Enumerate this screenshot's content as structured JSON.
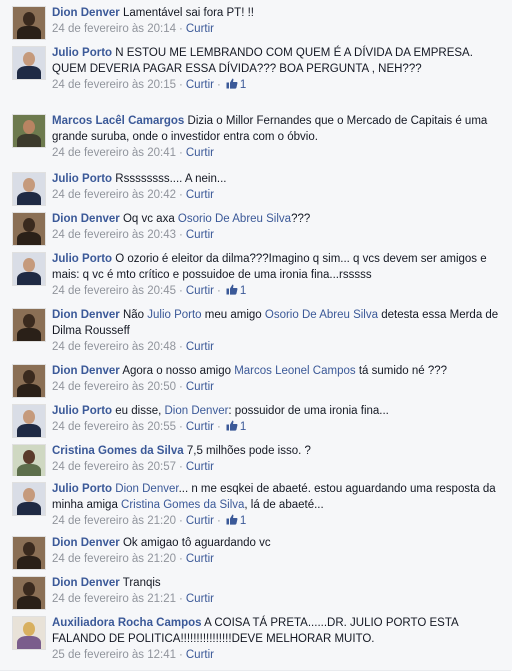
{
  "comments": [
    {
      "author": "Dion Denver",
      "avatar": "dark",
      "parts": [
        {
          "t": "Lamentável sai fora PT! !!"
        }
      ],
      "time": "24 de fevereiro às 20:14",
      "action": "Curtir",
      "likes": ""
    },
    {
      "author": "Julio Porto",
      "avatar": "suit",
      "parts": [
        {
          "t": "N ESTOU ME LEMBRANDO COM QUEM É A DÍVIDA DA EMPRESA. QUEM DEVERIA PAGAR ESSA DÍVIDA??? BOA PERGUNTA , NEH???"
        }
      ],
      "time": "24 de fevereiro às 20:15",
      "action": "Curtir",
      "likes": "1"
    },
    {
      "author": "Marcos Lacêl Camargos",
      "avatar": "tan",
      "parts": [
        {
          "t": "Dizia o Millor Fernandes que o Mercado de Capitais é uma grande suruba, onde o investidor entra com o óbvio."
        }
      ],
      "time": "24 de fevereiro às 20:41",
      "action": "Curtir",
      "likes": ""
    },
    {
      "author": "Julio Porto",
      "avatar": "suit",
      "parts": [
        {
          "t": "Rssssssss.... A nein..."
        }
      ],
      "time": "24 de fevereiro às 20:42",
      "action": "Curtir",
      "likes": ""
    },
    {
      "author": "Dion Denver",
      "avatar": "dark",
      "parts": [
        {
          "t": "Oq vc axa "
        },
        {
          "m": "Osorio De Abreu Silva"
        },
        {
          "t": "???"
        }
      ],
      "time": "24 de fevereiro às 20:43",
      "action": "Curtir",
      "likes": ""
    },
    {
      "author": "Julio Porto",
      "avatar": "suit",
      "parts": [
        {
          "t": "O ozorio é eleitor da dilma???Imagino q sim... q vcs devem ser amigos e mais: q vc é mto crítico e possuidoe de uma ironia fina...rsssss"
        }
      ],
      "time": "24 de fevereiro às 20:45",
      "action": "Curtir",
      "likes": "1"
    },
    {
      "author": "Dion Denver",
      "avatar": "dark",
      "parts": [
        {
          "t": "Não "
        },
        {
          "m": "Julio Porto"
        },
        {
          "t": " meu amigo "
        },
        {
          "m": "Osorio De Abreu Silva"
        },
        {
          "t": " detesta essa Merda de Dilma Rousseff"
        }
      ],
      "time": "24 de fevereiro às 20:48",
      "action": "Curtir",
      "likes": ""
    },
    {
      "author": "Dion Denver",
      "avatar": "dark",
      "parts": [
        {
          "t": "Agora o nosso amigo "
        },
        {
          "m": "Marcos Leonel Campos"
        },
        {
          "t": " tá sumido né ???"
        }
      ],
      "time": "24 de fevereiro às 20:50",
      "action": "Curtir",
      "likes": ""
    },
    {
      "author": "Julio Porto",
      "avatar": "suit",
      "parts": [
        {
          "t": "eu disse, "
        },
        {
          "m": "Dion Denver"
        },
        {
          "t": ": possuidor de uma ironia fina..."
        }
      ],
      "time": "24 de fevereiro às 20:55",
      "action": "Curtir",
      "likes": "1"
    },
    {
      "author": "Cristina Gomes da Silva",
      "avatar": "woman",
      "parts": [
        {
          "t": "7,5 milhões pode isso. ?"
        }
      ],
      "time": "24 de fevereiro às 20:57",
      "action": "Curtir",
      "likes": ""
    },
    {
      "author": "Julio Porto",
      "avatar": "suit",
      "parts": [
        {
          "m": "Dion Denver"
        },
        {
          "t": "... n me esqkei de abaeté. estou aguardando uma resposta da minha amiga "
        },
        {
          "m": "Cristina Gomes da Silva"
        },
        {
          "t": ", lá de abaeté..."
        }
      ],
      "time": "24 de fevereiro às 21:20",
      "action": "Curtir",
      "likes": "1"
    },
    {
      "author": "Dion Denver",
      "avatar": "dark",
      "parts": [
        {
          "t": "Ok amigao tô aguardando vc"
        }
      ],
      "time": "24 de fevereiro às 21:20",
      "action": "Curtir",
      "likes": ""
    },
    {
      "author": "Dion Denver",
      "avatar": "dark",
      "parts": [
        {
          "t": "Tranqis"
        }
      ],
      "time": "24 de fevereiro às 21:21",
      "action": "Curtir",
      "likes": ""
    },
    {
      "author": "Auxiliadora Rocha Campos",
      "avatar": "blonde",
      "parts": [
        {
          "t": "A COISA TÁ PRETA......DR. JULIO PORTO ESTA FALANDO DE POLITICA!!!!!!!!!!!!!!!!DEVE MELHORAR MUITO."
        }
      ],
      "time": "25 de fevereiro às 12:41",
      "action": "Curtir",
      "likes": ""
    }
  ],
  "colors": {
    "link": "#3b5998",
    "meta": "#90949c",
    "text": "#141823",
    "background": "#f6f7f9"
  },
  "icons": {
    "like": "thumbs-up-icon"
  }
}
